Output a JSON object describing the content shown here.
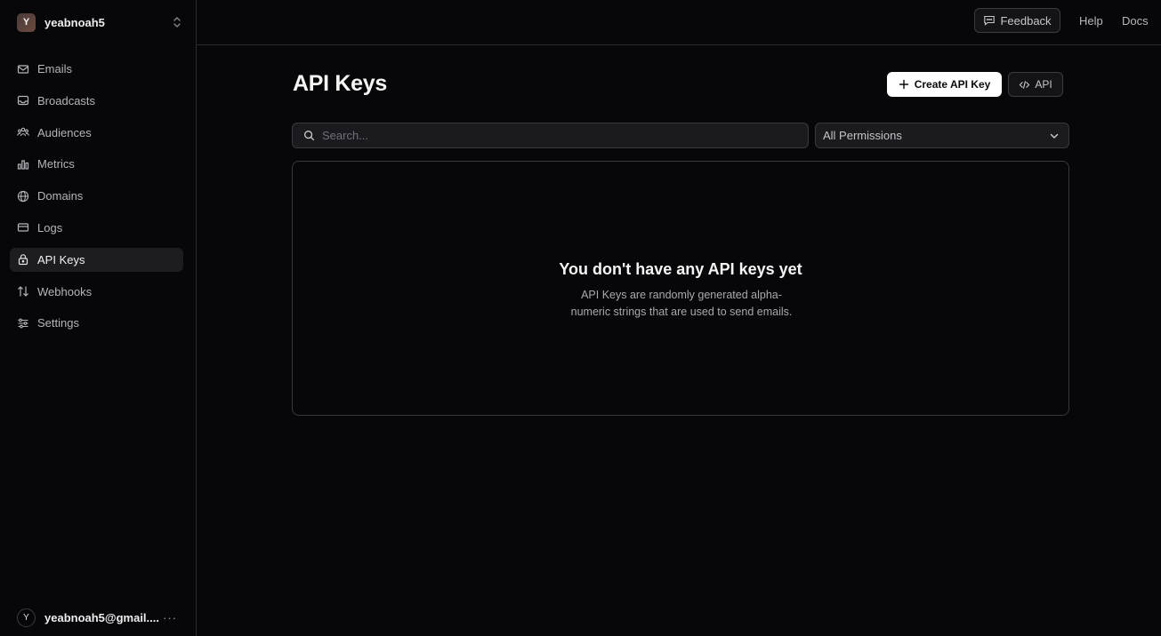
{
  "team": {
    "initial": "Y",
    "name": "yeabnoah5"
  },
  "nav": {
    "items": [
      {
        "label": "Emails",
        "icon": "mail-icon"
      },
      {
        "label": "Broadcasts",
        "icon": "inbox-icon"
      },
      {
        "label": "Audiences",
        "icon": "users-icon"
      },
      {
        "label": "Metrics",
        "icon": "bar-chart-icon"
      },
      {
        "label": "Domains",
        "icon": "globe-icon"
      },
      {
        "label": "Logs",
        "icon": "logs-icon"
      },
      {
        "label": "API Keys",
        "icon": "lock-icon",
        "active": true
      },
      {
        "label": "Webhooks",
        "icon": "arrows-icon"
      },
      {
        "label": "Settings",
        "icon": "sliders-icon"
      }
    ]
  },
  "user": {
    "initial": "Y",
    "email": "yeabnoah5@gmail....",
    "more": "···"
  },
  "topbar": {
    "feedback": "Feedback",
    "help": "Help",
    "docs": "Docs"
  },
  "page": {
    "title": "API Keys",
    "create_label": "Create API Key",
    "api_label": "API",
    "search_placeholder": "Search...",
    "permission_filter": "All Permissions"
  },
  "empty": {
    "title": "You don't have any API keys yet",
    "description": "API Keys are randomly generated alpha-numeric strings that are used to send emails."
  },
  "colors": {
    "background": "#07070a",
    "active_nav": "#1d1d21",
    "border": "#2a2a2e",
    "primary_button": "#ffffff"
  }
}
